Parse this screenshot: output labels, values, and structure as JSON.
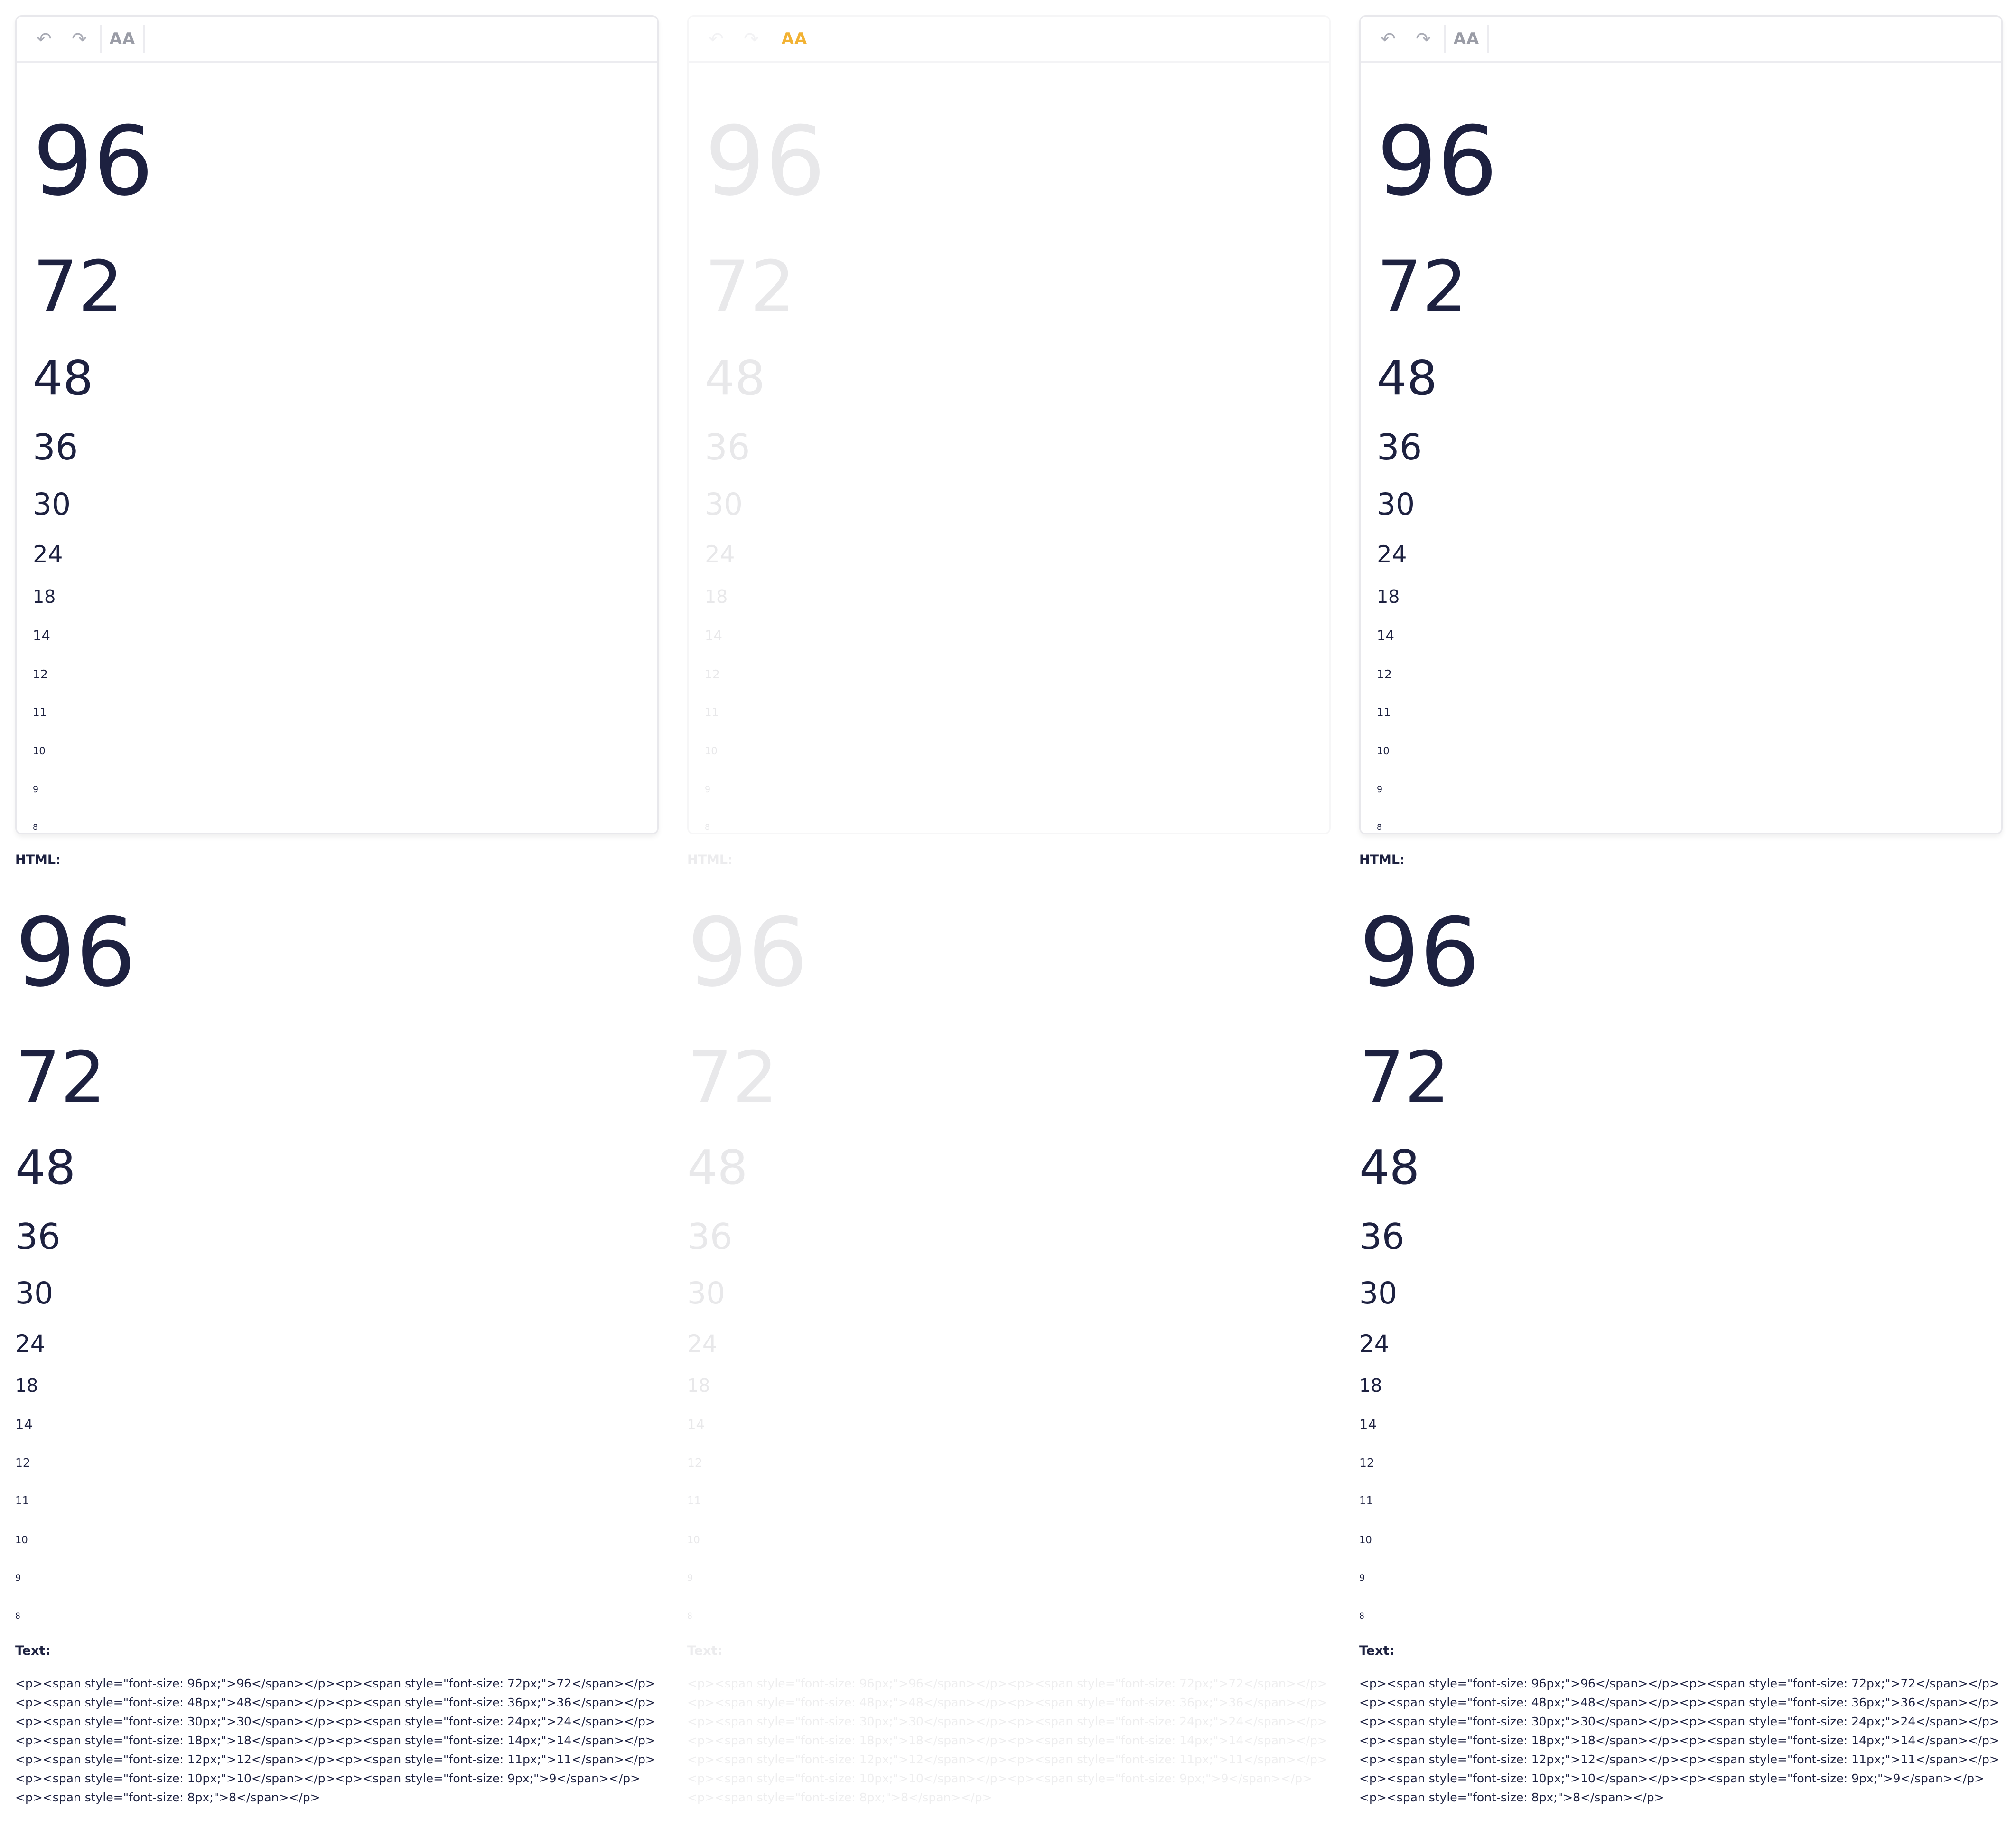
{
  "toolbar": {
    "undo_icon": "↶",
    "redo_icon": "↷",
    "font_size_icon": "AA"
  },
  "sizes": [
    "96",
    "72",
    "48",
    "36",
    "30",
    "24",
    "18",
    "14",
    "12",
    "11",
    "10",
    "9",
    "8"
  ],
  "labels": {
    "html": "HTML:",
    "text": "Text:"
  },
  "text_output": "<p><span style=\"font-size: 96px;\">96</span></p><p><span style=\"font-size: 72px;\">72</span></p><p><span style=\"font-size: 48px;\">48</span></p><p><span style=\"font-size: 36px;\">36</span></p><p><span style=\"font-size: 30px;\">30</span></p><p><span style=\"font-size: 24px;\">24</span></p><p><span style=\"font-size: 18px;\">18</span></p><p><span style=\"font-size: 14px;\">14</span></p><p><span style=\"font-size: 12px;\">12</span></p><p><span style=\"font-size: 11px;\">11</span></p><p><span style=\"font-size: 10px;\">10</span></p><p><span style=\"font-size: 9px;\">9</span></p><p><span style=\"font-size: 8px;\">8</span></p>",
  "colors": {
    "text": "#1d2140",
    "faded_text": "#e8e8ea",
    "accent_font_icon": "#f2b233",
    "border": "#e8e8ec"
  }
}
